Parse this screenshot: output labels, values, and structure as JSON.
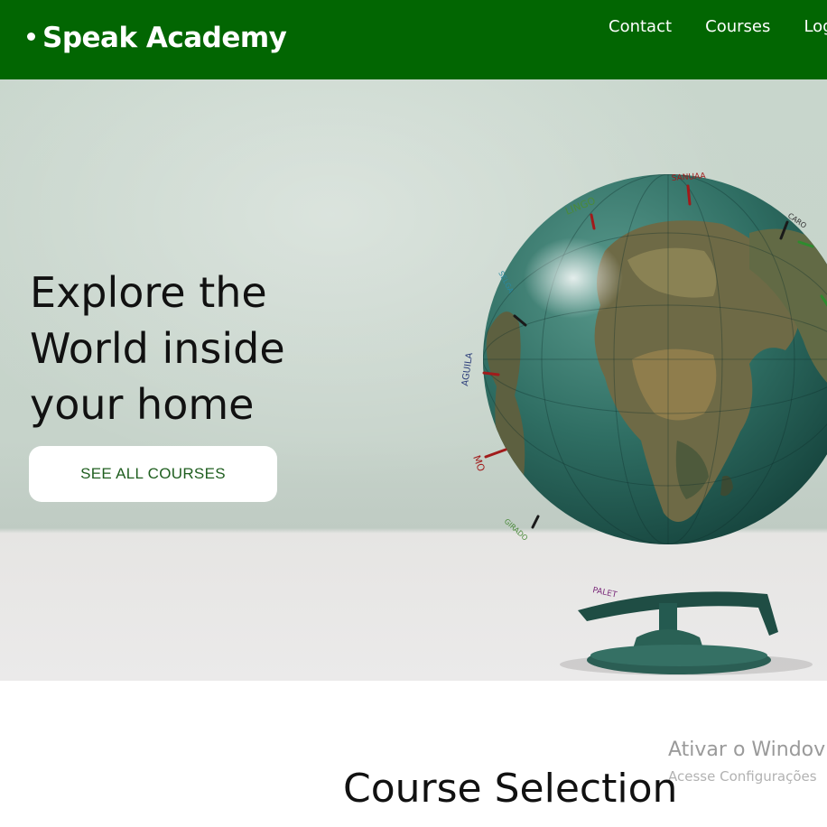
{
  "header": {
    "brand": "Speak Academy",
    "nav": [
      "Contact",
      "Courses",
      "Log"
    ]
  },
  "hero": {
    "title_lines": [
      "Explore the",
      "World inside",
      "your home"
    ],
    "cta_label": "SEE ALL COURSES",
    "globe_words": [
      "LINGO",
      "SANUAA",
      "CARO",
      "SELGA",
      "AGUILA",
      "MO",
      "GIRADO",
      "PALET"
    ]
  },
  "courses": {
    "title": "Course Selection"
  },
  "os_watermark": {
    "title": "Ativar o Windov",
    "subtitle": "Acesse Configurações"
  },
  "colors": {
    "header_bg": "#026602",
    "cta_text": "#1f5e1f",
    "globe_ocean": "#2f6e63"
  }
}
